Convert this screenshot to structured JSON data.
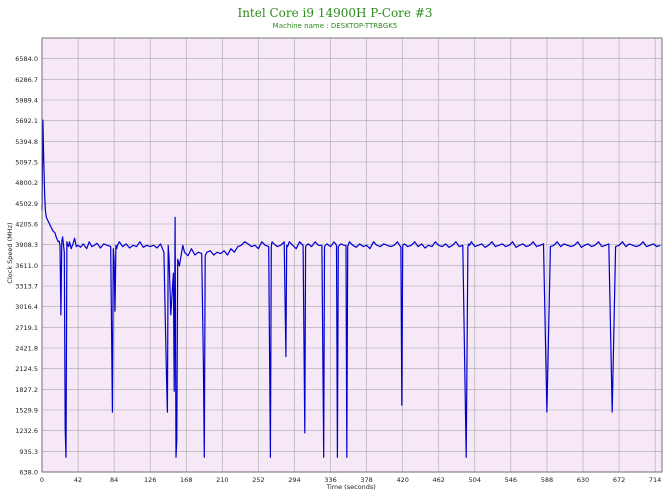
{
  "chart_data": {
    "type": "line",
    "title": "Intel Core i9 14900H P-Core #3",
    "subtitle": "Machine name : DESKTOP-TTRBGK5",
    "xlabel": "Time (seconds)",
    "ylabel": "Clock Speed (MHz)",
    "xlim": [
      0,
      722
    ],
    "ylim": [
      638.0,
      6881.5
    ],
    "x_ticks": [
      0,
      42,
      84,
      126,
      168,
      210,
      252,
      294,
      336,
      378,
      420,
      462,
      504,
      546,
      588,
      630,
      672,
      714
    ],
    "y_ticks": [
      638.0,
      935.3,
      1232.6,
      1529.9,
      1827.2,
      2124.5,
      2421.8,
      2719.1,
      3016.4,
      3313.7,
      3611.0,
      3908.3,
      4205.6,
      4502.9,
      4800.2,
      5097.5,
      5394.8,
      5692.1,
      5989.4,
      6286.7,
      6584.0
    ],
    "grid": true,
    "background_color": "#f6e8f7",
    "line_color": "#0000cc",
    "grid_color": "#a8a8a8",
    "title_color": "#2e8b1e",
    "series": [
      {
        "x": [
          0,
          1,
          2,
          3,
          4,
          5,
          7,
          9,
          11,
          13,
          15,
          17,
          19,
          20,
          21,
          22,
          23,
          24,
          26,
          27,
          28,
          29,
          30,
          31,
          32,
          34,
          36,
          38,
          40,
          42,
          45,
          48,
          52,
          55,
          58,
          61,
          64,
          68,
          72,
          76,
          80,
          82,
          83,
          84,
          85,
          86,
          87,
          88,
          90,
          94,
          98,
          102,
          106,
          110,
          114,
          118,
          122,
          126,
          130,
          134,
          138,
          142,
          145,
          146,
          147,
          148,
          150,
          152,
          153,
          154,
          155,
          156,
          157,
          158,
          160,
          162,
          164,
          166,
          170,
          174,
          178,
          182,
          186,
          188,
          189,
          190,
          192,
          196,
          200,
          204,
          208,
          212,
          216,
          220,
          224,
          228,
          232,
          236,
          240,
          244,
          248,
          252,
          256,
          260,
          264,
          266,
          267,
          268,
          270,
          274,
          278,
          282,
          284,
          285,
          286,
          288,
          292,
          296,
          300,
          304,
          306,
          307,
          308,
          310,
          314,
          318,
          322,
          326,
          328,
          329,
          330,
          332,
          336,
          340,
          343,
          344,
          345,
          348,
          352,
          354,
          355,
          356,
          358,
          362,
          366,
          370,
          374,
          378,
          382,
          386,
          390,
          394,
          398,
          402,
          406,
          410,
          414,
          418,
          419,
          420,
          422,
          426,
          430,
          434,
          438,
          442,
          446,
          450,
          454,
          458,
          462,
          466,
          470,
          474,
          478,
          482,
          486,
          490,
          494,
          496,
          497,
          498,
          500,
          504,
          508,
          512,
          516,
          520,
          524,
          528,
          532,
          536,
          540,
          544,
          548,
          552,
          556,
          560,
          564,
          568,
          572,
          576,
          580,
          584,
          588,
          592,
          596,
          600,
          604,
          608,
          612,
          616,
          620,
          624,
          628,
          632,
          636,
          640,
          644,
          648,
          652,
          656,
          660,
          664,
          668,
          672,
          676,
          680,
          684,
          688,
          692,
          696,
          700,
          704,
          708,
          712,
          716,
          720
        ],
        "y": [
          4400,
          5700,
          5150,
          4650,
          4400,
          4300,
          4250,
          4200,
          4150,
          4100,
          4080,
          4000,
          3950,
          3960,
          3900,
          2900,
          3950,
          4020,
          3800,
          1250,
          850,
          3950,
          3900,
          3880,
          3950,
          3850,
          3920,
          4000,
          3880,
          3900,
          3870,
          3920,
          3850,
          3950,
          3880,
          3900,
          3930,
          3860,
          3920,
          3900,
          3880,
          1500,
          3850,
          3700,
          2950,
          3900,
          3850,
          3900,
          3950,
          3880,
          3920,
          3860,
          3900,
          3880,
          3950,
          3870,
          3900,
          3880,
          3900,
          3860,
          3920,
          3800,
          2000,
          1500,
          3900,
          3700,
          2900,
          3300,
          3500,
          1800,
          4300,
          850,
          1100,
          3700,
          3600,
          3750,
          3900,
          3800,
          3750,
          3850,
          3760,
          3800,
          3780,
          2200,
          850,
          3750,
          3800,
          3820,
          3760,
          3800,
          3780,
          3820,
          3760,
          3850,
          3800,
          3880,
          3900,
          3950,
          3920,
          3880,
          3900,
          3850,
          3950,
          3900,
          3880,
          850,
          3900,
          3950,
          3920,
          3880,
          3900,
          3950,
          2300,
          3900,
          3880,
          3950,
          3900,
          3850,
          3950,
          3900,
          1200,
          3880,
          3900,
          3920,
          3880,
          3950,
          3900,
          3900,
          850,
          3880,
          3900,
          3920,
          3880,
          3950,
          3900,
          850,
          3880,
          3920,
          3900,
          3900,
          850,
          3880,
          3950,
          3900,
          3870,
          3920,
          3880,
          3900,
          3850,
          3950,
          3900,
          3880,
          3920,
          3900,
          3880,
          3900,
          3950,
          3870,
          1600,
          3900,
          3920,
          3880,
          3900,
          3950,
          3880,
          3920,
          3860,
          3900,
          3880,
          3950,
          3900,
          3880,
          3920,
          3870,
          3900,
          3950,
          3880,
          3900,
          850,
          3880,
          3920,
          3900,
          3950,
          3880,
          3900,
          3920,
          3870,
          3900,
          3950,
          3880,
          3900,
          3920,
          3880,
          3900,
          3950,
          3870,
          3900,
          3920,
          3880,
          3900,
          3950,
          3880,
          3900,
          3920,
          1500,
          3880,
          3900,
          3950,
          3880,
          3920,
          3900,
          3880,
          3900,
          3950,
          3870,
          3900,
          3920,
          3880,
          3900,
          3950,
          3880,
          3900,
          3920,
          1500,
          3880,
          3900,
          3950,
          3880,
          3920,
          3900,
          3880,
          3900,
          3950,
          3880,
          3900,
          3920,
          3880,
          3900
        ]
      }
    ]
  }
}
